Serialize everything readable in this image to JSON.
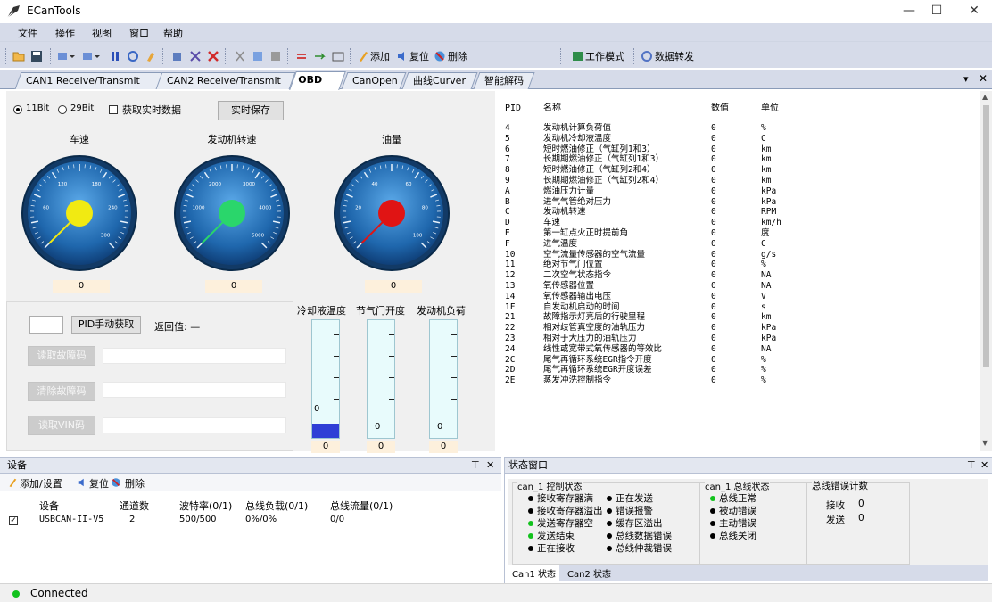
{
  "app": {
    "title": "ECanTools"
  },
  "menu": [
    "文件",
    "操作",
    "视图",
    "窗口",
    "帮助"
  ],
  "toolbar": {
    "add": "添加",
    "reset": "复位",
    "delete": "删除",
    "work_mode": "工作模式",
    "data_forward": "数据转发"
  },
  "tabs": [
    "CAN1 Receive/Transmit",
    "CAN2 Receive/Transmit",
    "OBD II",
    "CanOpen",
    "曲线Curver",
    "智能解码"
  ],
  "obd": {
    "radio_11": "11Bit",
    "radio_29": "29Bit",
    "realtime_check": "获取实时数据",
    "save_button": "实时保存",
    "gauges": [
      {
        "label": "车速",
        "value": "0",
        "color": "#f1ea12",
        "ticks": [
          "120",
          "180",
          "60",
          "240",
          "300"
        ]
      },
      {
        "label": "发动机转速",
        "value": "0",
        "color": "#2ad66b",
        "ticks": [
          "2000",
          "3000",
          "1000",
          "4000",
          "5000"
        ]
      },
      {
        "label": "油量",
        "value": "0",
        "color": "#e01414",
        "ticks": [
          "40",
          "60",
          "20",
          "80",
          "100"
        ]
      }
    ],
    "pid_button": "PID手动获取",
    "return_label": "返回值: —",
    "read_dtc": "读取故障码",
    "clear_dtc": "清除故障码",
    "read_vin": "读取VIN码",
    "bars": [
      {
        "label": "冷却液温度",
        "zero": "0",
        "value": "0",
        "level": 0.12
      },
      {
        "label": "节气门开度",
        "zero": "0",
        "value": "0",
        "level": 0
      },
      {
        "label": "发动机负荷",
        "zero": "0",
        "value": "0",
        "level": 0
      }
    ]
  },
  "pid_table": {
    "headers": [
      "PID",
      "名称",
      "数值",
      "单位"
    ],
    "rows": [
      [
        "4",
        "发动机计算负荷值",
        "0",
        "%"
      ],
      [
        "5",
        "发动机冷却液温度",
        "0",
        "C"
      ],
      [
        "6",
        "短时燃油修正（气缸列1和3）",
        "0",
        "km"
      ],
      [
        "7",
        "长期期燃油修正（气缸列1和3）",
        "0",
        "km"
      ],
      [
        "8",
        "短时燃油修正（气缸列2和4）",
        "0",
        "km"
      ],
      [
        "9",
        "长期期燃油修正（气缸列2和4）",
        "0",
        "km"
      ],
      [
        "A",
        "燃油压力计量",
        "0",
        "kPa"
      ],
      [
        "B",
        "进气气管绝对压力",
        "0",
        "kPa"
      ],
      [
        "C",
        "发动机转速",
        "0",
        "RPM"
      ],
      [
        "D",
        "车速",
        "0",
        "km/h"
      ],
      [
        "E",
        "第一缸点火正时提前角",
        "0",
        "度"
      ],
      [
        "F",
        "进气温度",
        "0",
        "C"
      ],
      [
        "10",
        "空气流量传感器的空气流量",
        "0",
        "g/s"
      ],
      [
        "11",
        "绝对节气门位置",
        "0",
        "%"
      ],
      [
        "12",
        "二次空气状态指令",
        "0",
        "NA"
      ],
      [
        "13",
        "氧传感器位置",
        "0",
        "NA"
      ],
      [
        "14",
        "氧传感器输出电压",
        "0",
        "V"
      ],
      [
        "1F",
        "自发动机启动的时间",
        "0",
        "s"
      ],
      [
        "21",
        "故障指示灯亮后的行驶里程",
        "0",
        "km"
      ],
      [
        "22",
        "相对歧管真空度的油轨压力",
        "0",
        "kPa"
      ],
      [
        "23",
        "相对于大压力的油轨压力",
        "0",
        "kPa"
      ],
      [
        "24",
        "线性或宽带式氧传感器的等效比",
        "0",
        "NA"
      ],
      [
        "2C",
        "尾气再循环系统EGR指令开度",
        "0",
        "%"
      ],
      [
        "2D",
        "尾气再循环系统EGR开度误差",
        "0",
        "%"
      ],
      [
        "2E",
        "蒸发冲洗控制指令",
        "0",
        "%"
      ]
    ]
  },
  "device_panel": {
    "title": "设备",
    "add": "添加/设置",
    "reset": "复位",
    "delete": "删除",
    "headers": [
      "设备",
      "通道数",
      "波特率(0/1)",
      "总线负载(0/1)",
      "总线流量(0/1)"
    ],
    "row": [
      "USBCAN-II-V5",
      "2",
      "500/500",
      "0%/0%",
      "0/0"
    ]
  },
  "status_panel": {
    "title": "状态窗口",
    "control_title": "can_1 控制状态",
    "control_col1": [
      "接收寄存器满",
      "接收寄存器溢出",
      "发送寄存器空",
      "发送结束",
      "正在接收"
    ],
    "control_col2": [
      "正在发送",
      "错误报警",
      "缓存区溢出",
      "总线数据错误",
      "总线仲裁错误"
    ],
    "bus_title": "can_1 总线状态",
    "bus_items": [
      "总线正常",
      "被动错误",
      "主动错误",
      "总线关闭"
    ],
    "err_title": "总线错误计数",
    "recv_label": "接收",
    "recv_value": "0",
    "send_label": "发送",
    "send_value": "0",
    "tabs": [
      "Can1 状态",
      "Can2 状态"
    ]
  },
  "status": {
    "text": "Connected"
  },
  "colors": {
    "accent": "#d6dbe9",
    "green": "#12c21d"
  }
}
